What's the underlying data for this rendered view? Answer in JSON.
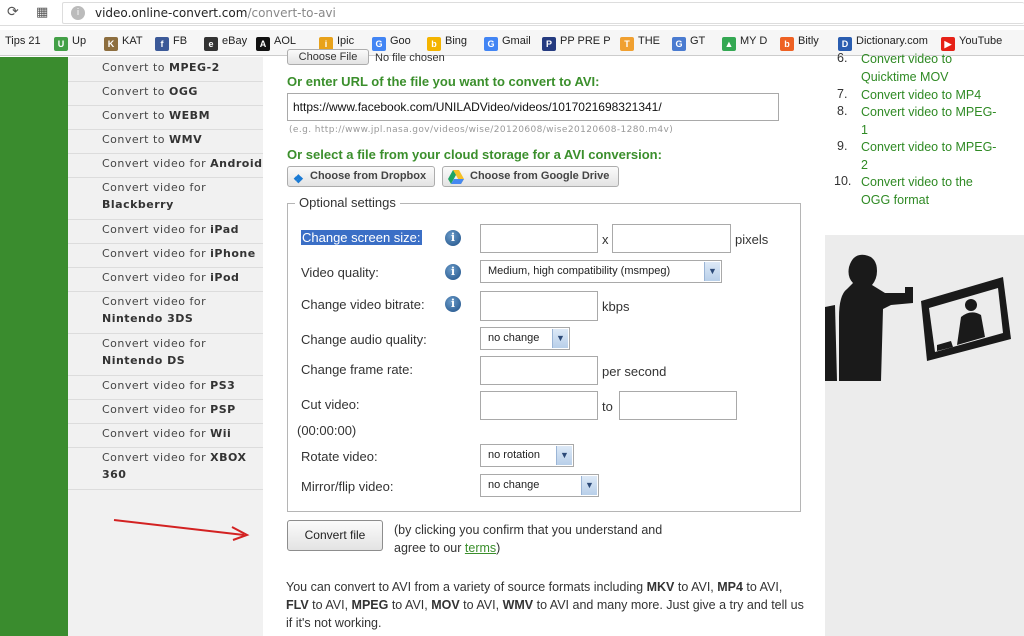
{
  "browser": {
    "url_host": "video.online-convert.com",
    "url_path": "/convert-to-avi",
    "bookmarks": [
      {
        "label": "Tips 21",
        "icon": "bookmark-icon",
        "color": "#1565c0"
      },
      {
        "label": "Up",
        "icon": "up-icon",
        "color": "#43a047"
      },
      {
        "label": "KAT",
        "icon": "kat-icon",
        "color": "#8d6e3f"
      },
      {
        "label": "FB",
        "icon": "facebook-icon",
        "color": "#3b5998"
      },
      {
        "label": "eBay",
        "icon": "ebay-icon",
        "color": "#333333"
      },
      {
        "label": "AOL",
        "icon": "aol-icon",
        "color": "#111111"
      },
      {
        "label": "Ipic",
        "icon": "ipic-icon",
        "color": "#e8a21b"
      },
      {
        "label": "Goo",
        "icon": "google-icon",
        "color": "#4285f4"
      },
      {
        "label": "Bing",
        "icon": "bing-icon",
        "color": "#f4b400"
      },
      {
        "label": "Gmail",
        "icon": "google-icon",
        "color": "#4285f4"
      },
      {
        "label": "PP PRE P",
        "icon": "paypal-icon",
        "color": "#253b80"
      },
      {
        "label": "THE",
        "icon": "the-icon",
        "color": "#f0a030"
      },
      {
        "label": "GT",
        "icon": "translate-icon",
        "color": "#4a7bd0"
      },
      {
        "label": "MY D",
        "icon": "drive-icon",
        "color": "#34a853"
      },
      {
        "label": "Bitly",
        "icon": "bitly-icon",
        "color": "#ee6123"
      },
      {
        "label": "Dictionary.com",
        "icon": "dictionary-icon",
        "color": "#2a5db0"
      },
      {
        "label": "YouTube",
        "icon": "youtube-icon",
        "color": "#e62117"
      }
    ]
  },
  "left_links": [
    {
      "pre": "Convert to ",
      "bold": "MPEG-2",
      "post": ""
    },
    {
      "pre": "Convert to ",
      "bold": "OGG",
      "post": ""
    },
    {
      "pre": "Convert to ",
      "bold": "WEBM",
      "post": ""
    },
    {
      "pre": "Convert to ",
      "bold": "WMV",
      "post": ""
    },
    {
      "pre": "Convert video for ",
      "bold": "Android",
      "post": ""
    },
    {
      "pre": "Convert video for",
      "bold": "Blackberry",
      "post": "",
      "wrap": true
    },
    {
      "pre": "Convert video for ",
      "bold": "iPad",
      "post": ""
    },
    {
      "pre": "Convert video for ",
      "bold": "iPhone",
      "post": ""
    },
    {
      "pre": "Convert video for ",
      "bold": "iPod",
      "post": ""
    },
    {
      "pre": "Convert video for",
      "bold": "Nintendo 3DS",
      "post": "",
      "wrap": true
    },
    {
      "pre": "Convert video for",
      "bold": "Nintendo DS",
      "post": "",
      "wrap": true
    },
    {
      "pre": "Convert video for ",
      "bold": "PS3",
      "post": ""
    },
    {
      "pre": "Convert video for ",
      "bold": "PSP",
      "post": ""
    },
    {
      "pre": "Convert video for ",
      "bold": "Wii",
      "post": ""
    },
    {
      "pre": "Convert video for ",
      "bold": "XBOX",
      "post": "360",
      "wrap2": true
    }
  ],
  "main": {
    "choose_file_label": "Choose File",
    "no_file_text": "No file chosen",
    "url_heading": "Or enter URL of the file you want to convert to AVI:",
    "url_value": "https://www.facebook.com/UNILADVideo/videos/1017021698321341/",
    "url_example": "(e.g. http://www.jpl.nasa.gov/videos/wise/20120608/wise20120608-1280.m4v)",
    "cloud_heading": "Or select a file from your cloud storage for a AVI conversion:",
    "dropbox_label": "Choose from Dropbox",
    "gdrive_label": "Choose from Google Drive",
    "optional_legend": "Optional settings",
    "screen_size_label": "Change screen size:",
    "x_sep": "x",
    "pixels_unit": "pixels",
    "quality_label": "Video quality:",
    "quality_value": "Medium, high compatibility (msmpeg)",
    "bitrate_label": "Change video bitrate:",
    "kbps_unit": "kbps",
    "audio_label": "Change audio quality:",
    "audio_value": "no change",
    "framerate_label": "Change frame rate:",
    "per_second_unit": "per second",
    "cut_label": "Cut video:",
    "cut_format": "(00:00:00)",
    "to_sep": "to",
    "rotate_label": "Rotate video:",
    "rotate_value": "no rotation",
    "mirror_label": "Mirror/flip video:",
    "mirror_value": "no change",
    "convert_label": "Convert file",
    "confirm_line1": "(by clicking you confirm that you understand and",
    "confirm_line2_pre": "agree to our ",
    "terms_link": "terms",
    "confirm_line2_post": ")",
    "desc_segments": [
      {
        "t": "You can convert to AVI from a variety of source formats including ",
        "b": false
      },
      {
        "t": "MKV",
        "b": true
      },
      {
        "t": " to AVI, ",
        "b": false
      },
      {
        "t": "MP4",
        "b": true
      },
      {
        "t": " to AVI, ",
        "b": false
      },
      {
        "t": "FLV",
        "b": true
      },
      {
        "t": " to AVI, ",
        "b": false
      },
      {
        "t": "MPEG",
        "b": true
      },
      {
        "t": " to AVI, ",
        "b": false
      },
      {
        "t": "MOV",
        "b": true
      },
      {
        "t": " to AVI, ",
        "b": false
      },
      {
        "t": "WMV",
        "b": true
      },
      {
        "t": " to AVI and many more. Just give a try and tell us if it's not working.",
        "b": false
      }
    ]
  },
  "right_links": [
    {
      "num": "6.",
      "line1": "Convert video to",
      "line2": "Quicktime MOV"
    },
    {
      "num": "7.",
      "line1": "Convert video to MP4",
      "line2": ""
    },
    {
      "num": "8.",
      "line1": "Convert video to MPEG-",
      "line2": "1"
    },
    {
      "num": "9.",
      "line1": "Convert video to MPEG-",
      "line2": "2"
    },
    {
      "num": "10.",
      "line1": "Convert video to the",
      "line2": "OGG format"
    }
  ],
  "colors": {
    "accent_green": "#3b8f2c",
    "annotation_arrow": "#d32222"
  }
}
